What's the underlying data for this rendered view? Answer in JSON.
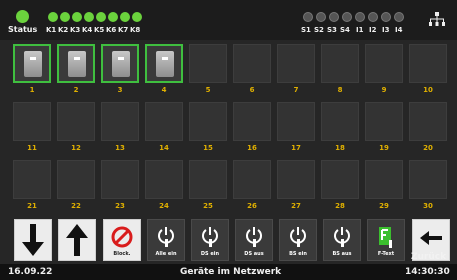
{
  "topbar": {
    "status_label": "Status",
    "k_labels": [
      "K1",
      "K2",
      "K3",
      "K4",
      "K5",
      "K6",
      "K7",
      "K8"
    ],
    "s_labels": [
      "S1",
      "S2",
      "S3",
      "S4",
      "I1",
      "I2",
      "I3",
      "I4"
    ],
    "network_icon": "network-icon"
  },
  "grid": {
    "cells": [
      {
        "num": "1",
        "active": true
      },
      {
        "num": "2",
        "active": true
      },
      {
        "num": "3",
        "active": true
      },
      {
        "num": "4",
        "active": true
      },
      {
        "num": "5",
        "active": false
      },
      {
        "num": "6",
        "active": false
      },
      {
        "num": "7",
        "active": false
      },
      {
        "num": "8",
        "active": false
      },
      {
        "num": "9",
        "active": false
      },
      {
        "num": "10",
        "active": false
      },
      {
        "num": "11",
        "active": false
      },
      {
        "num": "12",
        "active": false
      },
      {
        "num": "13",
        "active": false
      },
      {
        "num": "14",
        "active": false
      },
      {
        "num": "15",
        "active": false
      },
      {
        "num": "16",
        "active": false
      },
      {
        "num": "17",
        "active": false
      },
      {
        "num": "18",
        "active": false
      },
      {
        "num": "19",
        "active": false
      },
      {
        "num": "20",
        "active": false
      },
      {
        "num": "21",
        "active": false
      },
      {
        "num": "22",
        "active": false
      },
      {
        "num": "23",
        "active": false
      },
      {
        "num": "24",
        "active": false
      },
      {
        "num": "25",
        "active": false
      },
      {
        "num": "26",
        "active": false
      },
      {
        "num": "27",
        "active": false
      },
      {
        "num": "28",
        "active": false
      },
      {
        "num": "29",
        "active": false
      },
      {
        "num": "30",
        "active": false
      }
    ]
  },
  "buttons": {
    "down": "",
    "up": "",
    "block": "Block.",
    "all_on": "Alle ein",
    "ds_on": "DS ein",
    "ds_off": "DS aus",
    "bs_on": "BS ein",
    "bs_off": "BS aus",
    "ftext": "F-Text",
    "back": "Zurück"
  },
  "footer": {
    "date": "16.09.22",
    "title": "Geräte im Netzwerk",
    "time": "14:30:30"
  },
  "colors": {
    "green": "#6bd23d",
    "number_yellow": "#e0b000"
  }
}
